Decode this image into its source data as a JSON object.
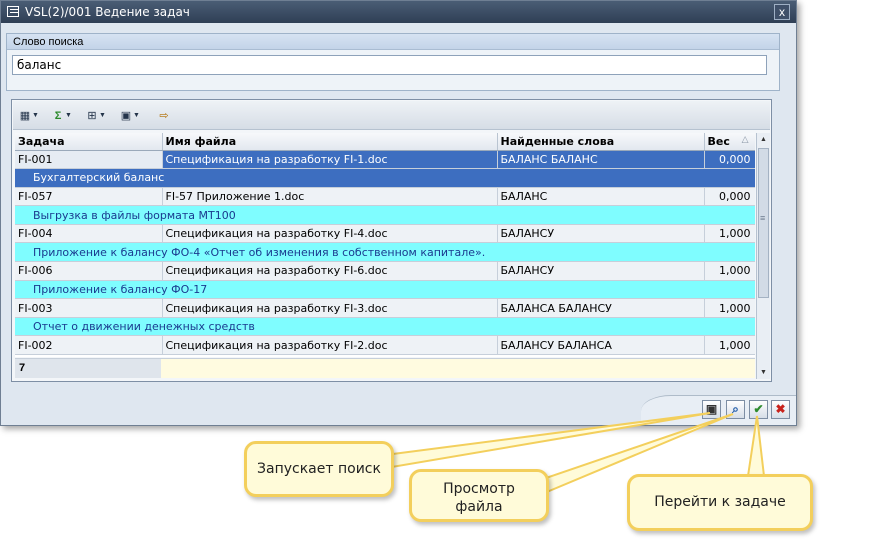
{
  "window": {
    "title": "VSL(2)/001 Ведение задач",
    "close_label": "x"
  },
  "search": {
    "group_label": "Слово поиска",
    "value": "баланс"
  },
  "grid": {
    "columns": [
      "Задача",
      "Имя файла",
      "Найденные слова",
      "Вес"
    ],
    "rows": [
      {
        "task": "FI-001",
        "file": "Спецификация на разработку FI-1.doc",
        "words": "БАЛАНС БАЛАНС",
        "weight": "0,000",
        "desc": "Бухгалтерский баланс"
      },
      {
        "task": "FI-057",
        "file": "FI-57 Приложение 1.doc",
        "words": "БАЛАНС",
        "weight": "0,000",
        "desc": "Выгрузка в файлы формата МТ100"
      },
      {
        "task": "FI-004",
        "file": "Спецификация на разработку FI-4.doc",
        "words": "БАЛАНСУ",
        "weight": "1,000",
        "desc": "Приложение к балансу ФО-4 «Отчет об изменения в собственном капитале»."
      },
      {
        "task": "FI-006",
        "file": "Спецификация на разработку FI-6.doc",
        "words": "БАЛАНСУ",
        "weight": "1,000",
        "desc": "Приложение к балансу ФО-17"
      },
      {
        "task": "FI-003",
        "file": "Спецификация на разработку FI-3.doc",
        "words": "БАЛАНСА БАЛАНСУ",
        "weight": "1,000",
        "desc": "Отчет о движении денежных средств"
      },
      {
        "task": "FI-002",
        "file": "Спецификация на разработку FI-2.doc",
        "words": "БАЛАНСУ БАЛАНСА",
        "weight": "1,000",
        "desc": ""
      }
    ],
    "count": "7"
  },
  "callouts": {
    "search": "Запускает поиск",
    "view": "Просмотр файла",
    "goto": "Перейти к задаче"
  },
  "colors": {
    "selection": "#3d6ec0",
    "description_row": "#7ffdff",
    "callout_border": "#f3cf5c"
  }
}
